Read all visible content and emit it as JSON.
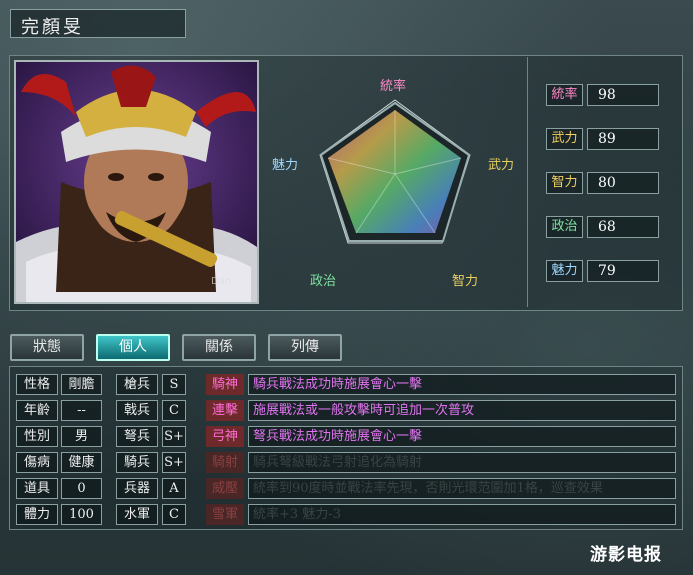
{
  "character": {
    "name": "完顏旻"
  },
  "radar": {
    "labels": {
      "leadership": "統率",
      "war": "武力",
      "intelligence": "智力",
      "politics": "政治",
      "charm": "魅力"
    },
    "colors": {
      "leadership": "#ff8ac8",
      "war": "#e8d060",
      "intelligence": "#e8d060",
      "politics": "#7fe0a0",
      "charm": "#9fd8ff"
    }
  },
  "stats": [
    {
      "label": "統率",
      "value": "98",
      "color": "#ff8ac8"
    },
    {
      "label": "武力",
      "value": "89",
      "color": "#f0d060"
    },
    {
      "label": "智力",
      "value": "80",
      "color": "#f0d060"
    },
    {
      "label": "政治",
      "value": "68",
      "color": "#7fe0a0"
    },
    {
      "label": "魅力",
      "value": "79",
      "color": "#9fd8ff"
    }
  ],
  "tabs": [
    {
      "label": "狀態",
      "active": false
    },
    {
      "label": "個人",
      "active": true
    },
    {
      "label": "關係",
      "active": false
    },
    {
      "label": "列傳",
      "active": false
    }
  ],
  "info": [
    {
      "label": "性格",
      "value": "剛膽"
    },
    {
      "label": "年齡",
      "value": "--"
    },
    {
      "label": "性別",
      "value": "男"
    },
    {
      "label": "傷病",
      "value": "健康"
    },
    {
      "label": "道具",
      "value": "0"
    },
    {
      "label": "體力",
      "value": "100"
    }
  ],
  "aptitude": [
    {
      "label": "槍兵",
      "grade": "S"
    },
    {
      "label": "戟兵",
      "grade": "C"
    },
    {
      "label": "弩兵",
      "grade": "S+"
    },
    {
      "label": "騎兵",
      "grade": "S+"
    },
    {
      "label": "兵器",
      "grade": "A"
    },
    {
      "label": "水軍",
      "grade": "C"
    }
  ],
  "skills": [
    {
      "name": "騎神",
      "desc": "騎兵戰法成功時施展會心一擊",
      "active": true
    },
    {
      "name": "連擊",
      "desc": "施展戰法或一般攻擊時可追加一次普攻",
      "active": true
    },
    {
      "name": "弓神",
      "desc": "弩兵戰法成功時施展會心一擊",
      "active": true
    },
    {
      "name": "騎射",
      "desc": "騎兵弩級戰法弓射追化為騎射",
      "active": false
    },
    {
      "name": "威壓",
      "desc": "統率到90度時並戰法率先現，否則光環范圍加1格，巡查效果",
      "active": false
    },
    {
      "name": "雪軍",
      "desc": "統率+3 魅力-3",
      "active": false
    }
  ],
  "watermark": "游影电报"
}
